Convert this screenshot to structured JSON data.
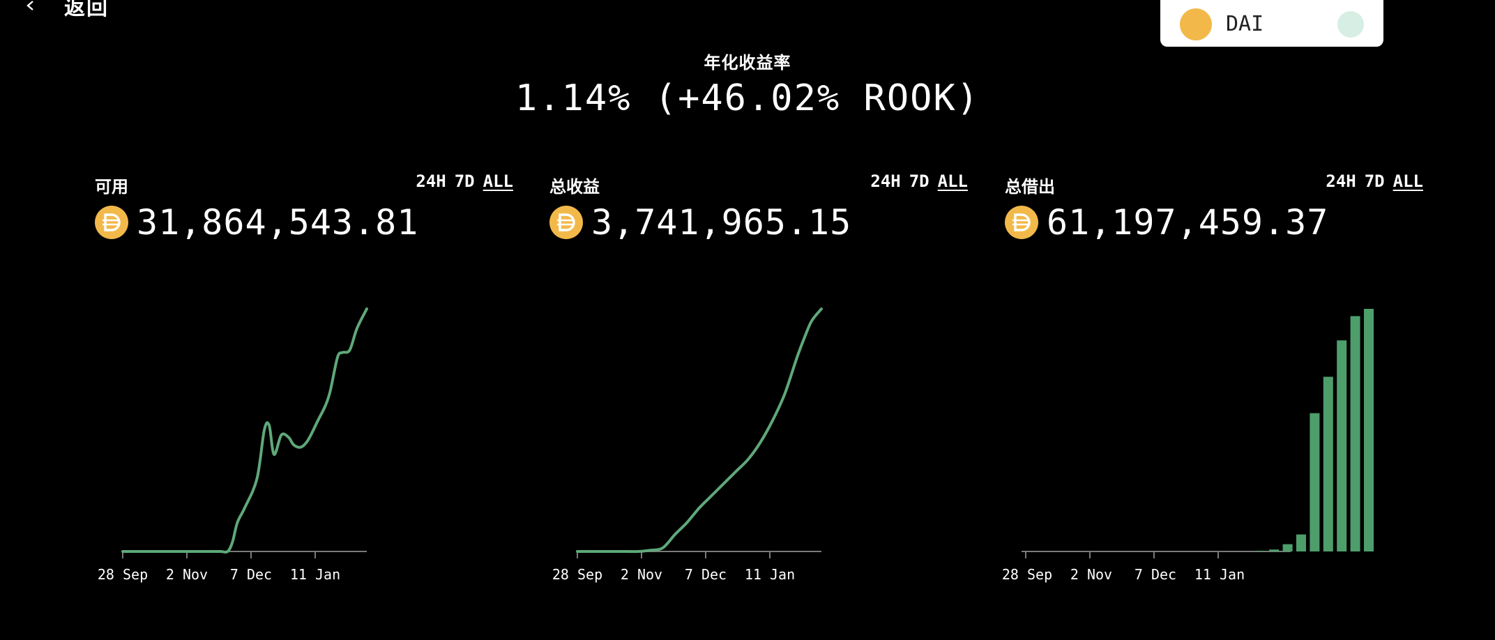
{
  "nav": {
    "back_label": "返回"
  },
  "token_selector": {
    "symbol": "DAI"
  },
  "apy": {
    "label": "年化收益率",
    "value": "1.14% (+46.02% ROOK)"
  },
  "colors": {
    "line": "#5fa87a",
    "bar": "#4e9e6c",
    "axis": "#7a7a7a",
    "coin": "#f2b94a"
  },
  "range_tabs": [
    "24H",
    "7D",
    "ALL"
  ],
  "panels": [
    {
      "id": "available",
      "title": "可用",
      "value": "31,864,543.81",
      "active_range": "ALL"
    },
    {
      "id": "total-earnings",
      "title": "总收益",
      "value": "3,741,965.15",
      "active_range": "ALL"
    },
    {
      "id": "total-borrowed",
      "title": "总借出",
      "value": "61,197,459.37",
      "active_range": "ALL"
    }
  ],
  "chart_data": [
    {
      "type": "line",
      "title": "可用",
      "x_ticks": [
        "28 Sep",
        "2 Nov",
        "7 Dec",
        "11 Jan"
      ],
      "x": [
        0,
        10,
        20,
        30,
        35,
        40,
        43,
        45,
        47,
        50,
        55,
        58,
        60,
        62,
        65,
        68,
        70,
        73,
        76,
        80,
        83,
        85,
        88,
        90,
        93,
        96,
        100
      ],
      "values": [
        0,
        0,
        0,
        0,
        0,
        0,
        0,
        4,
        12,
        18,
        30,
        50,
        52,
        40,
        48,
        47,
        44,
        43,
        46,
        54,
        60,
        66,
        80,
        82,
        83,
        92,
        100
      ]
    },
    {
      "type": "line",
      "title": "总收益",
      "x_ticks": [
        "28 Sep",
        "2 Nov",
        "7 Dec",
        "11 Jan"
      ],
      "x": [
        0,
        10,
        20,
        25,
        30,
        35,
        40,
        45,
        50,
        55,
        60,
        65,
        70,
        75,
        80,
        85,
        90,
        93,
        96,
        100
      ],
      "values": [
        0,
        0,
        0,
        0,
        0.5,
        1.5,
        7,
        12,
        18,
        23,
        28,
        33,
        38,
        45,
        54,
        65,
        80,
        88,
        95,
        100
      ]
    },
    {
      "type": "bar",
      "title": "总借出",
      "x_ticks": [
        "28 Sep",
        "2 Nov",
        "7 Dec",
        "11 Jan"
      ],
      "values": [
        0,
        0,
        0,
        0,
        0,
        0,
        0,
        0,
        0,
        0,
        0,
        0,
        0,
        0,
        0,
        0,
        0,
        0.3,
        0.8,
        3,
        7,
        57,
        72,
        87,
        97,
        100
      ]
    }
  ]
}
